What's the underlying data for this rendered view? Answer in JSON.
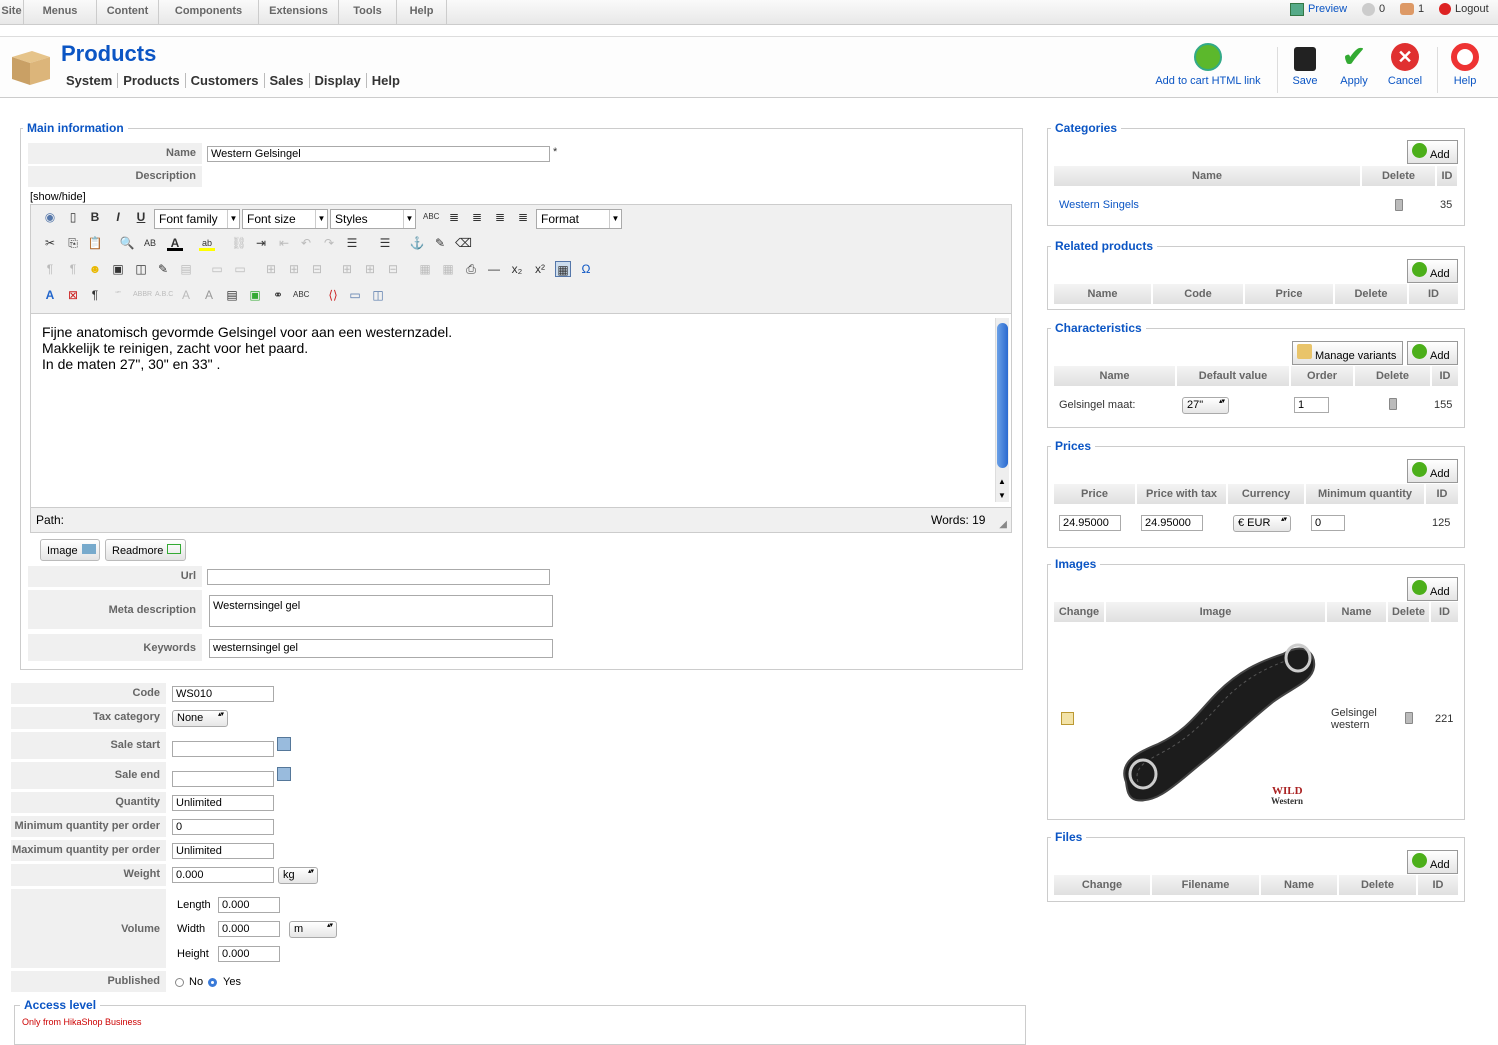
{
  "topmenu": {
    "items": [
      "Site",
      "Menus",
      "Content",
      "Components",
      "Extensions",
      "Tools",
      "Help"
    ],
    "preview": "Preview",
    "count1": "0",
    "count2": "1",
    "logout": "Logout"
  },
  "header": {
    "title": "Products",
    "submenu": [
      "System",
      "Products",
      "Customers",
      "Sales",
      "Display",
      "Help"
    ]
  },
  "toolbar": {
    "addcart": "Add to cart HTML link",
    "save": "Save",
    "apply": "Apply",
    "cancel": "Cancel",
    "help": "Help"
  },
  "main": {
    "legend": "Main information",
    "name_label": "Name",
    "name_value": "Western Gelsingel",
    "required": "*",
    "desc_label": "Description",
    "showhide": "[show/hide]",
    "editor": {
      "font_family": "Font family",
      "font_size": "Font size",
      "styles": "Styles",
      "format": "Format",
      "lines": [
        "Fijne anatomisch gevormde Gelsingel voor aan een westernzadel.",
        "Makkelijk te reinigen, zacht voor het paard.",
        "In de maten 27\", 30\" en 33\" ."
      ],
      "path": "Path:",
      "words": "Words: 19"
    },
    "image_btn": "Image",
    "readmore_btn": "Readmore",
    "url_label": "Url",
    "url_value": "",
    "meta_label": "Meta description",
    "meta_value": "Westernsingel gel",
    "kw_label": "Keywords",
    "kw_value": "westernsingel gel"
  },
  "details": {
    "code_label": "Code",
    "code": "WS010",
    "tax_label": "Tax category",
    "tax": "None",
    "sale_start_label": "Sale start",
    "sale_end_label": "Sale end",
    "qty_label": "Quantity",
    "qty": "Unlimited",
    "minq_label": "Minimum quantity per order",
    "minq": "0",
    "maxq_label": "Maximum quantity per order",
    "maxq": "Unlimited",
    "weight_label": "Weight",
    "weight": "0.000",
    "weight_unit": "kg",
    "volume_label": "Volume",
    "length_label": "Length",
    "length": "0.000",
    "width_label": "Width",
    "width": "0.000",
    "vol_unit": "m",
    "height_label": "Height",
    "height": "0.000",
    "published_label": "Published",
    "no": "No",
    "yes": "Yes",
    "access_legend": "Access level",
    "access_note": "Only from HikaShop Business"
  },
  "right": {
    "add": "Add",
    "categories": {
      "legend": "Categories",
      "cols": [
        "Name",
        "Delete",
        "ID"
      ],
      "row": {
        "name": "Western Singels",
        "id": "35"
      }
    },
    "related": {
      "legend": "Related products",
      "cols": [
        "Name",
        "Code",
        "Price",
        "Delete",
        "ID"
      ]
    },
    "characteristics": {
      "legend": "Characteristics",
      "manage": "Manage variants",
      "cols": [
        "Name",
        "Default value",
        "Order",
        "Delete",
        "ID"
      ],
      "row": {
        "name": "Gelsingel maat:",
        "default": "27\"",
        "order": "1",
        "id": "155"
      }
    },
    "prices": {
      "legend": "Prices",
      "cols": [
        "Price",
        "Price with tax",
        "Currency",
        "Minimum quantity",
        "ID"
      ],
      "row": {
        "price": "24.95000",
        "price_tax": "24.95000",
        "currency": "€ EUR",
        "minq": "0",
        "id": "125"
      }
    },
    "images": {
      "legend": "Images",
      "cols": [
        "Change",
        "Image",
        "Name",
        "Delete",
        "ID"
      ],
      "row": {
        "name": "Gelsingel western",
        "id": "221",
        "logo": "WILD Western"
      }
    },
    "files": {
      "legend": "Files",
      "cols": [
        "Change",
        "Filename",
        "Name",
        "Delete",
        "ID"
      ]
    }
  }
}
